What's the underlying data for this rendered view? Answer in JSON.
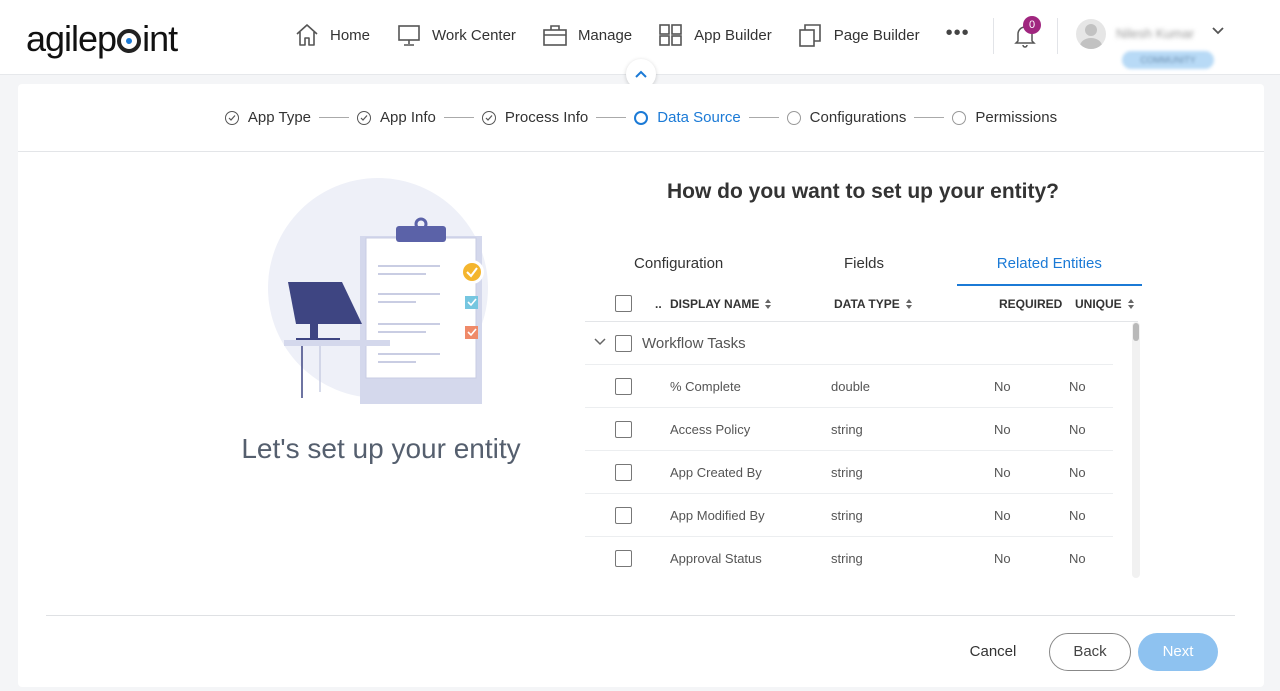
{
  "brand": {
    "logo_text_pre": "agilep",
    "logo_text_post": "int"
  },
  "nav": {
    "items": [
      {
        "label": "Home",
        "icon": "home-icon"
      },
      {
        "label": "Work Center",
        "icon": "monitor-icon"
      },
      {
        "label": "Manage",
        "icon": "briefcase-icon"
      },
      {
        "label": "App Builder",
        "icon": "grid-icon"
      },
      {
        "label": "Page Builder",
        "icon": "copy-icon"
      }
    ],
    "more": "•••",
    "notification_count": "0",
    "user_name": "Nilesh Kumar",
    "user_tier": "COMMUNITY"
  },
  "stepper": {
    "steps": [
      {
        "label": "App Type",
        "state": "done"
      },
      {
        "label": "App Info",
        "state": "done"
      },
      {
        "label": "Process Info",
        "state": "done"
      },
      {
        "label": "Data Source",
        "state": "active"
      },
      {
        "label": "Configurations",
        "state": "pending"
      },
      {
        "label": "Permissions",
        "state": "pending"
      }
    ]
  },
  "left": {
    "title": "Let's set up your entity"
  },
  "right": {
    "question": "How do you want to set up your entity?",
    "tabs": [
      "Configuration",
      "Fields",
      "Related Entities"
    ],
    "active_tab": "Related Entities",
    "table": {
      "headers": {
        "ellipsis": "..",
        "display_name": "DISPLAY NAME",
        "data_type": "DATA TYPE",
        "required": "REQUIRED",
        "unique": "UNIQUE"
      },
      "group": "Workflow Tasks",
      "rows": [
        {
          "name": "% Complete",
          "type": "double",
          "required": "No",
          "unique": "No"
        },
        {
          "name": "Access Policy",
          "type": "string",
          "required": "No",
          "unique": "No"
        },
        {
          "name": "App Created By",
          "type": "string",
          "required": "No",
          "unique": "No"
        },
        {
          "name": "App Modified By",
          "type": "string",
          "required": "No",
          "unique": "No"
        },
        {
          "name": "Approval Status",
          "type": "string",
          "required": "No",
          "unique": "No"
        }
      ]
    }
  },
  "footer": {
    "cancel": "Cancel",
    "back": "Back",
    "next": "Next"
  },
  "colors": {
    "accent": "#1b7ad6",
    "next_button": "#8ec2f0",
    "badge": "#a0267f"
  }
}
